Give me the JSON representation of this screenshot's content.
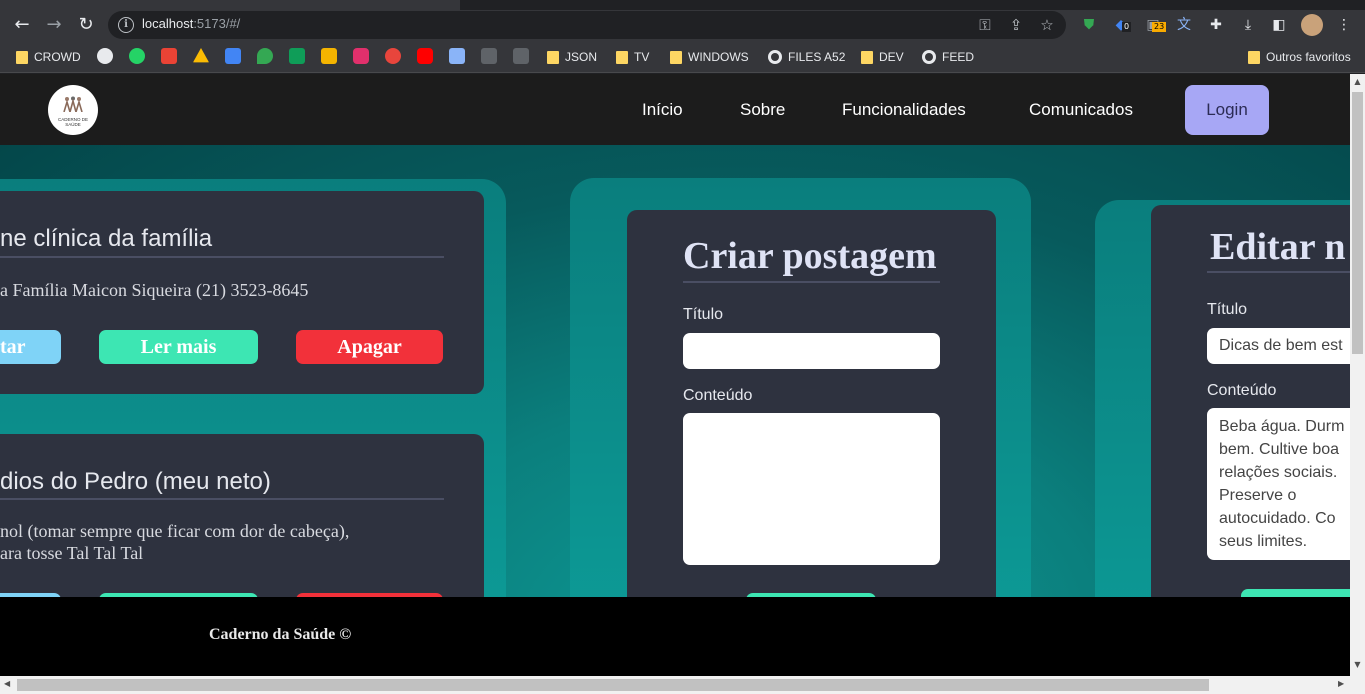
{
  "browser": {
    "url_host": "localhost",
    "url_rest": ":5173/#/",
    "bookmarks": [
      "CROWD",
      "JSON",
      "TV",
      "WINDOWS",
      "FILES A52",
      "DEV",
      "FEED"
    ],
    "other_bookmarks": "Outros favoritos",
    "ext_badge_1": "0",
    "ext_badge_2": "23"
  },
  "nav": {
    "logo_text": "CADERNO DE SAÚDE",
    "links": [
      "Início",
      "Sobre",
      "Funcionalidades",
      "Comunicados"
    ],
    "login": "Login"
  },
  "posts": [
    {
      "title": "ne clínica da família",
      "body_lines": [
        "a Família Maicon Siqueira (21) 3523-8645"
      ],
      "buttons": [
        "tar",
        "Ler mais",
        "Apagar"
      ]
    },
    {
      "title": "dios do Pedro (meu neto)",
      "body_lines": [
        "nol (tomar sempre que ficar com dor de cabeça),",
        "ara tosse Tal Tal Tal"
      ]
    }
  ],
  "create_form": {
    "title": "Criar postagem",
    "title_label": "Título",
    "title_value": "",
    "content_label": "Conteúdo",
    "content_value": ""
  },
  "edit_form": {
    "title": "Editar n",
    "title_label": "Título",
    "title_value": "Dicas de bem est",
    "content_label": "Conteúdo",
    "content_value": "Beba água. Durm\nbem. Cultive boa\nrelações sociais.\nPreserve o\nautocuidado. Co\nseus limites."
  },
  "footer": {
    "text": "Caderno da Saúde ©"
  },
  "colors": {
    "edit_btn": "#7fd3f7",
    "read_btn": "#3de6b3",
    "delete_btn": "#f2313a",
    "login_btn": "#a7a7f5",
    "card_bg": "#2e323f"
  }
}
